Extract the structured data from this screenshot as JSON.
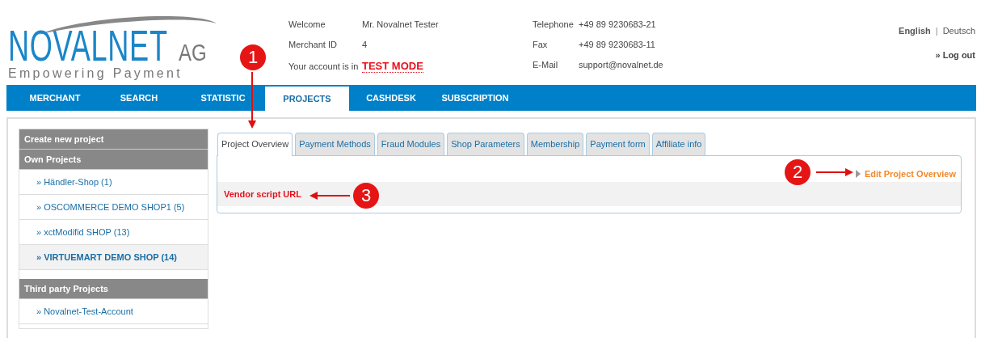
{
  "logo": {
    "name": "NOVALNET",
    "suffix": "AG",
    "tagline": "Empowering Payment"
  },
  "account": [
    {
      "label": "Welcome",
      "value": "Mr. Novalnet Tester",
      "kind": "text"
    },
    {
      "label": "Merchant ID",
      "value": "4",
      "kind": "text"
    },
    {
      "label": "Your account is in",
      "value": "TEST MODE",
      "kind": "alert"
    }
  ],
  "contact": [
    {
      "label": "Telephone",
      "value": "+49 89 9230683-21"
    },
    {
      "label": "Fax",
      "value": "+49 89 9230683-11"
    },
    {
      "label": "E-Mail",
      "value": "support@novalnet.de"
    }
  ],
  "languages": [
    {
      "label": "English",
      "selected": true
    },
    {
      "label": "Deutsch",
      "selected": false
    }
  ],
  "language_separator": "|",
  "logout": "» Log out",
  "nav": [
    {
      "label": "MERCHANT",
      "selected": false
    },
    {
      "label": "SEARCH",
      "selected": false
    },
    {
      "label": "STATISTIC",
      "selected": false
    },
    {
      "label": "PROJECTS",
      "selected": true
    },
    {
      "label": "CASHDESK",
      "selected": false
    },
    {
      "label": "SUBSCRIPTION",
      "selected": false
    }
  ],
  "sidebar": {
    "sections": [
      {
        "title": "Create new project"
      },
      {
        "title": "Own Projects",
        "items": [
          {
            "label": "» Händler-Shop (1)",
            "selected": false
          },
          {
            "label": "» OSCOMMERCE DEMO SHOP1 (5)",
            "selected": false
          },
          {
            "label": "» xctModifid SHOP (13)",
            "selected": false
          },
          {
            "label": "» VIRTUEMART DEMO SHOP (14)",
            "selected": true
          }
        ]
      },
      {
        "title": "Third party Projects",
        "items": [
          {
            "label": "» Novalnet-Test-Account",
            "selected": false
          }
        ]
      }
    ]
  },
  "tabs": [
    {
      "label": "Project Overview",
      "selected": true
    },
    {
      "label": "Payment Methods",
      "selected": false
    },
    {
      "label": "Fraud Modules",
      "selected": false
    },
    {
      "label": "Shop Parameters",
      "selected": false
    },
    {
      "label": "Membership",
      "selected": false
    },
    {
      "label": "Payment form",
      "selected": false
    },
    {
      "label": "Affiliate info",
      "selected": false
    }
  ],
  "edit_link": "Edit Project Overview",
  "field_label": "Vendor script URL",
  "callouts": [
    {
      "number": "1"
    },
    {
      "number": "2"
    },
    {
      "number": "3"
    }
  ]
}
